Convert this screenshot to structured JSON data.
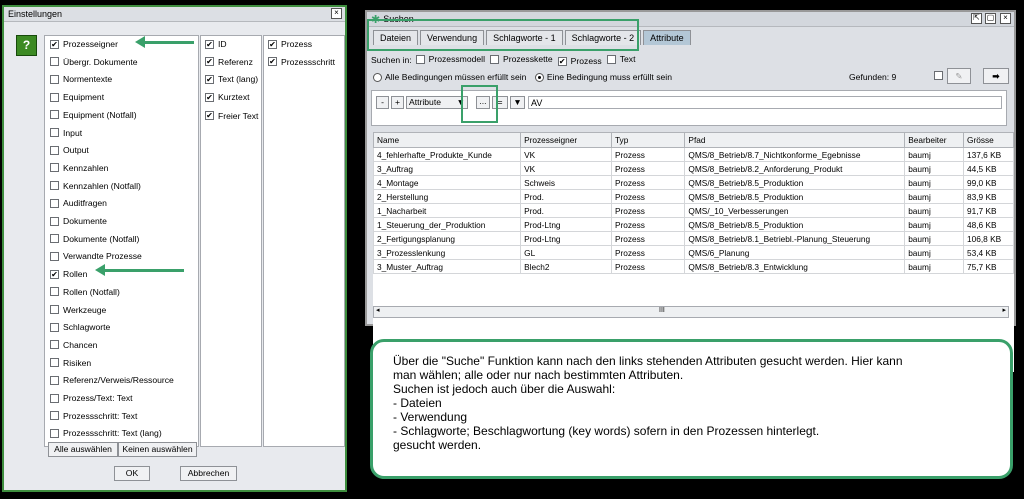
{
  "einstellungen": {
    "title": "Einstellungen",
    "help_label": "?",
    "col1": [
      {
        "label": "Prozesseigner",
        "checked": true
      },
      {
        "label": "Übergr. Dokumente",
        "checked": false
      },
      {
        "label": "Normentexte",
        "checked": false
      },
      {
        "label": "Equipment",
        "checked": false
      },
      {
        "label": "Equipment (Notfall)",
        "checked": false
      },
      {
        "label": "Input",
        "checked": false
      },
      {
        "label": "Output",
        "checked": false
      },
      {
        "label": "Kennzahlen",
        "checked": false
      },
      {
        "label": "Kennzahlen (Notfall)",
        "checked": false
      },
      {
        "label": "Auditfragen",
        "checked": false
      },
      {
        "label": "Dokumente",
        "checked": false
      },
      {
        "label": "Dokumente (Notfall)",
        "checked": false
      },
      {
        "label": "Verwandte Prozesse",
        "checked": false
      },
      {
        "label": "Rollen",
        "checked": true
      },
      {
        "label": "Rollen (Notfall)",
        "checked": false
      },
      {
        "label": "Werkzeuge",
        "checked": false
      },
      {
        "label": "Schlagworte",
        "checked": false
      },
      {
        "label": "Chancen",
        "checked": false
      },
      {
        "label": "Risiken",
        "checked": false
      },
      {
        "label": "Referenz/Verweis/Ressource",
        "checked": false
      },
      {
        "label": "Prozess/Text: Text",
        "checked": false
      },
      {
        "label": "Prozessschritt: Text",
        "checked": false
      },
      {
        "label": "Prozessschritt: Text (lang)",
        "checked": false
      }
    ],
    "col2": [
      {
        "label": "ID",
        "checked": true
      },
      {
        "label": "Referenz",
        "checked": true
      },
      {
        "label": "Text (lang)",
        "checked": true
      },
      {
        "label": "Kurztext",
        "checked": true
      },
      {
        "label": "Freier Text",
        "checked": true
      }
    ],
    "col3": [
      {
        "label": "Prozess",
        "checked": true
      },
      {
        "label": "Prozessschritt",
        "checked": true
      }
    ],
    "select_all": "Alle auswählen",
    "deselect_all": "Keinen auswählen",
    "ok": "OK",
    "cancel": "Abbrechen"
  },
  "suchen": {
    "title": "Suchen",
    "tabs": [
      "Dateien",
      "Verwendung",
      "Schlagworte - 1",
      "Schlagworte - 2",
      "Attribute"
    ],
    "search_in_label": "Suchen in:",
    "scope": [
      {
        "label": "Prozessmodell",
        "checked": false
      },
      {
        "label": "Prozesskette",
        "checked": false
      },
      {
        "label": "Prozess",
        "checked": true
      },
      {
        "label": "Text",
        "checked": false
      }
    ],
    "radio_all": "Alle Bedingungen müssen erfüllt sein",
    "radio_any": "Eine Bedingung muss erfüllt sein",
    "found": "Gefunden: 9",
    "filter_minus": "-",
    "filter_plus": "+",
    "filter_field": "Attribute",
    "filter_more": "...",
    "filter_op": "=",
    "filter_value": "AV",
    "columns": [
      "Name",
      "Prozesseigner",
      "Typ",
      "Pfad",
      "Bearbeiter",
      "Grösse"
    ],
    "rows": [
      [
        "4_fehlerhafte_Produkte_Kunde",
        "VK",
        "Prozess",
        "QMS/8_Betrieb/8.7_Nichtkonforme_Egebnisse",
        "baumj",
        "137,6 KB"
      ],
      [
        "3_Auftrag",
        "VK",
        "Prozess",
        "QMS/8_Betrieb/8.2_Anforderung_Produkt",
        "baumj",
        "44,5 KB"
      ],
      [
        "4_Montage",
        "Schweis",
        "Prozess",
        "QMS/8_Betrieb/8.5_Produktion",
        "baumj",
        "99,0 KB"
      ],
      [
        "2_Herstellung",
        "Prod.",
        "Prozess",
        "QMS/8_Betrieb/8.5_Produktion",
        "baumj",
        "83,9 KB"
      ],
      [
        "1_Nacharbeit",
        "Prod.",
        "Prozess",
        "QMS/_10_Verbesserungen",
        "baumj",
        "91,7 KB"
      ],
      [
        "1_Steuerung_der_Produktion",
        "Prod-Ltng",
        "Prozess",
        "QMS/8_Betrieb/8.5_Produktion",
        "baumj",
        "48,6 KB"
      ],
      [
        "2_Fertigungsplanung",
        "Prod-Ltng",
        "Prozess",
        "QMS/8_Betrieb/8.1_Betriebl.-Planung_Steuerung",
        "baumj",
        "106,8 KB"
      ],
      [
        "3_Prozesslenkung",
        "GL",
        "Prozess",
        "QMS/6_Planung",
        "baumj",
        "53,4 KB"
      ],
      [
        "3_Muster_Auftrag",
        "Blech2",
        "Prozess",
        "QMS/8_Betrieb/8.3_Entwicklung",
        "baumj",
        "75,7 KB"
      ]
    ],
    "scroll_left": "◂",
    "scroll_mid": "III",
    "scroll_right": "▸"
  },
  "callout": {
    "lines": [
      "Über die \"Suche\" Funktion kann nach den links stehenden Attributen gesucht werden. Hier kann",
      "man wählen; alle oder nur nach bestimmten Attributen.",
      "Suchen ist jedoch auch über die Auswahl:",
      "- Dateien",
      "- Verwendung",
      "- Schlagworte; Beschlagwortung (key words) sofern in den Prozessen hinterlegt.",
      "gesucht werden."
    ]
  },
  "colors": {
    "accent_green": "#3aa06a",
    "active_tab": "#b3c7d6"
  }
}
